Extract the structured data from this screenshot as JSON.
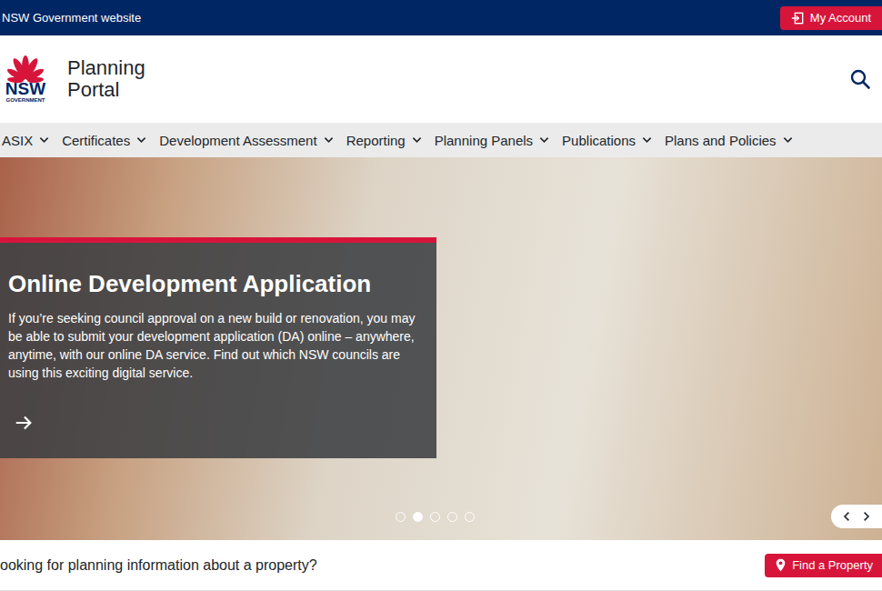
{
  "topbar": {
    "title": "NSW Government website",
    "account_button": "My Account"
  },
  "header": {
    "logo": {
      "text": "NSW",
      "subtext": "GOVERNMENT"
    },
    "site_title": [
      "Planning",
      "Portal"
    ]
  },
  "nav": {
    "items": [
      {
        "label": "ASIX"
      },
      {
        "label": "Certificates"
      },
      {
        "label": "Development Assessment"
      },
      {
        "label": "Reporting"
      },
      {
        "label": "Planning Panels"
      },
      {
        "label": "Publications"
      },
      {
        "label": "Plans and Policies"
      }
    ]
  },
  "hero": {
    "title": "Online Development Application",
    "body": "If you’re seeking council approval on a new build or renovation, you may be able to submit your development application (DA) online – anywhere, anytime, with our online DA service. Find out which NSW councils are using this exciting digital service.",
    "slides": [
      {
        "selected": false
      },
      {
        "selected": true
      },
      {
        "selected": false
      },
      {
        "selected": false
      },
      {
        "selected": false
      }
    ]
  },
  "property_bar": {
    "prompt": "ooking for planning information about a property?",
    "button": "Find a Property"
  }
}
